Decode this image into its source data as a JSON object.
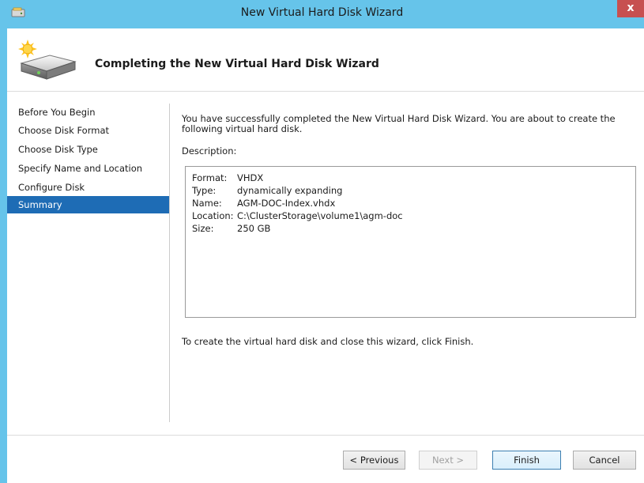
{
  "window": {
    "title": "New Virtual Hard Disk Wizard",
    "close_glyph": "x"
  },
  "header": {
    "heading": "Completing the New Virtual Hard Disk Wizard",
    "icon": "hard-disk-wizard-icon"
  },
  "nav": {
    "items": [
      {
        "label": "Before You Begin",
        "selected": false
      },
      {
        "label": "Choose Disk Format",
        "selected": false
      },
      {
        "label": "Choose Disk Type",
        "selected": false
      },
      {
        "label": "Specify Name and Location",
        "selected": false
      },
      {
        "label": "Configure Disk",
        "selected": false
      },
      {
        "label": "Summary",
        "selected": true
      }
    ]
  },
  "main": {
    "intro": "You have successfully completed the New Virtual Hard Disk Wizard. You are about to create the following virtual hard disk.",
    "description_label": "Description:",
    "description": {
      "rows": [
        {
          "key": "Format:",
          "value": "VHDX"
        },
        {
          "key": "Type:",
          "value": "dynamically expanding"
        },
        {
          "key": "Name:",
          "value": "AGM-DOC-Index.vhdx"
        },
        {
          "key": "Location:",
          "value": "C:\\ClusterStorage\\volume1\\agm-doc"
        },
        {
          "key": "Size:",
          "value": "250 GB"
        }
      ]
    },
    "finish_text": "To create the virtual hard disk and close this wizard, click Finish."
  },
  "footer": {
    "previous": "< Previous",
    "next": "Next >",
    "finish": "Finish",
    "cancel": "Cancel"
  },
  "colors": {
    "titlebar": "#66c4ea",
    "nav_selected": "#1e6cb5",
    "close_button": "#c75050"
  }
}
